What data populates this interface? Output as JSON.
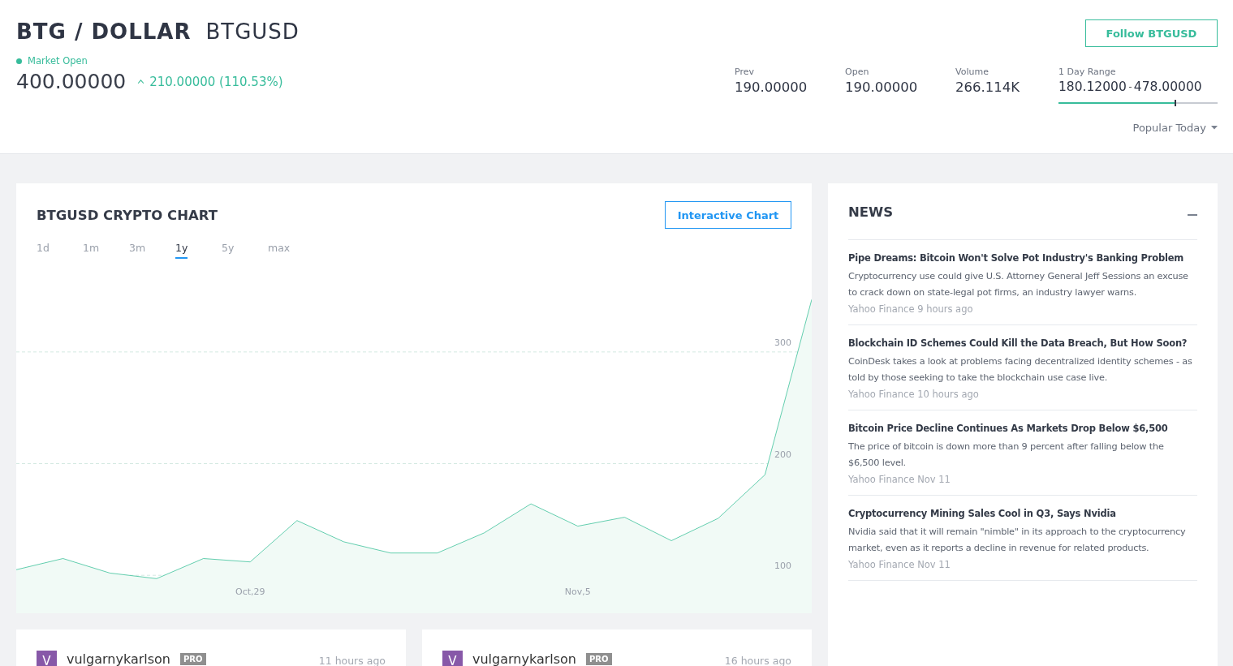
{
  "header": {
    "title": "BTG / DOLLAR",
    "symbol": "BTGUSD",
    "follow_button": "Follow BTGUSD",
    "market_status": {
      "label": "Market Open",
      "open": true
    },
    "price": "400.00000",
    "change": {
      "text": "210.00000 (110.53%)"
    },
    "stats": [
      {
        "label": "Prev",
        "value": "190.00000"
      },
      {
        "label": "Open",
        "value": "190.00000"
      },
      {
        "label": "Volume",
        "value": "266.114K"
      }
    ],
    "day_range": {
      "label": "1 Day Range",
      "low": "180.12000",
      "high": "478.00000",
      "level": 0.74
    },
    "popular_menu": "Popular Today"
  },
  "chart_card": {
    "title": "BTGUSD CRYPTO CHART",
    "button": "Interactive Chart",
    "ranges": [
      {
        "label": "1d",
        "selected": false
      },
      {
        "label": "1m",
        "selected": false
      },
      {
        "label": "3m",
        "selected": false
      },
      {
        "label": "1y",
        "selected": true
      },
      {
        "label": "5y",
        "selected": false
      },
      {
        "label": "max",
        "selected": false
      }
    ],
    "chart_data": {
      "type": "area",
      "categories": [
        null,
        null,
        null,
        null,
        null,
        "Oct,29",
        null,
        null,
        null,
        null,
        null,
        null,
        "Nov,5",
        null,
        null,
        null,
        null,
        null
      ],
      "ylim": [
        66,
        451
      ],
      "yticks": [
        100,
        200,
        300
      ],
      "grid": true,
      "series": [
        {
          "color": "#3cc29b",
          "values": [
            105,
            115,
            102,
            97,
            115,
            112,
            149,
            130,
            120,
            120,
            138,
            164,
            144,
            152,
            131,
            151,
            190,
            347
          ]
        }
      ]
    }
  },
  "news": {
    "title": "NEWS",
    "items": [
      {
        "headline": "Pipe Dreams: Bitcoin Won't Solve Pot Industry's Banking Problem",
        "summary": "Cryptocurrency use could give U.S. Attorney General Jeff Sessions an excuse to crack down on state-legal pot firms, an industry lawyer warns.",
        "source": "Yahoo Finance 9 hours ago"
      },
      {
        "headline": "Blockchain ID Schemes Could Kill the Data Breach, But How Soon?",
        "summary": "CoinDesk takes a look at problems facing decentralized identity schemes - as told by those seeking to take the blockchain use case live.",
        "source": "Yahoo Finance 10 hours ago"
      },
      {
        "headline": "Bitcoin Price Decline Continues As Markets Drop Below $6,500",
        "summary": "The price of bitcoin is down more than 9 percent after falling below the $6,500 level.",
        "source": "Yahoo Finance Nov 11"
      },
      {
        "headline": "Cryptocurrency Mining Sales Cool in Q3, Says Nvidia",
        "summary": "Nvidia said that it will remain \"nimble\" in its approach to the cryptocurrency market, even as it reports a decline in revenue for related products.",
        "source": "Yahoo Finance Nov 11"
      }
    ]
  },
  "ideas": [
    {
      "avatar": "V",
      "author": "vulgarnykarlson",
      "badge": "PRO",
      "time": "11 hours ago"
    },
    {
      "avatar": "V",
      "author": "vulgarnykarlson",
      "badge": "PRO",
      "time": "16 hours ago"
    }
  ]
}
